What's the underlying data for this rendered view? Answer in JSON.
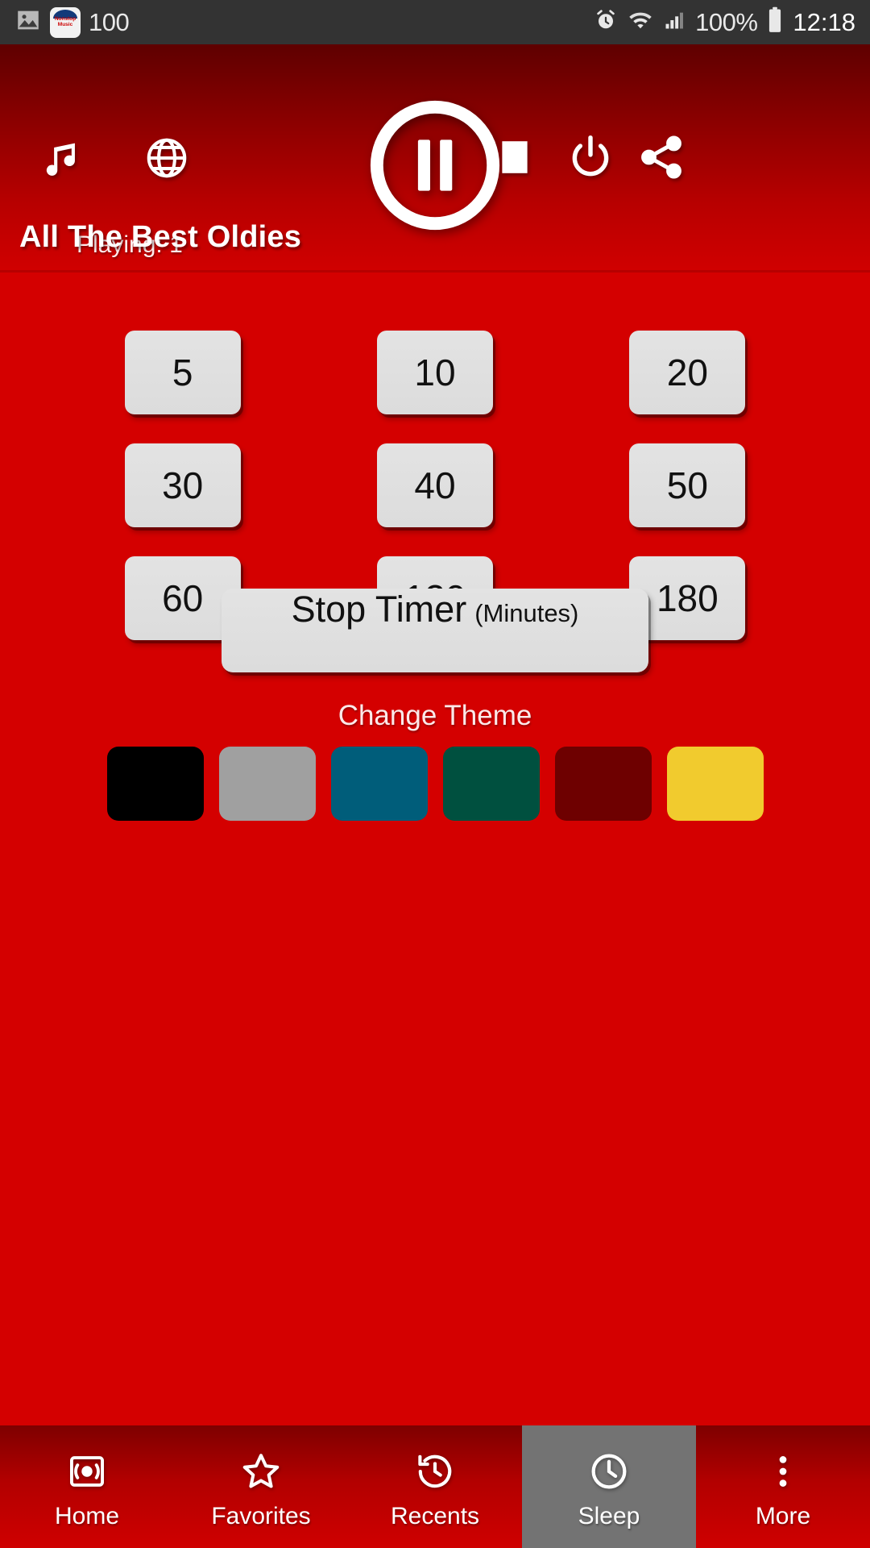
{
  "status_bar": {
    "left_icons": [
      "image-icon",
      "app-notification-icon"
    ],
    "app_badge_text": "Nonstop Music",
    "notification_count": "100",
    "right_icons": [
      "alarm-icon",
      "wifi-icon",
      "signal-icon",
      "battery-icon"
    ],
    "battery_percent": "100%",
    "time": "12:18"
  },
  "header": {
    "background_top": "#5e0000",
    "background_bottom": "#d10000",
    "music_icon": "music-note-icon",
    "globe_icon": "globe-icon",
    "pause_icon": "pause-circle-icon",
    "stop_icon": "stop-square-icon",
    "power_icon": "power-icon",
    "share_icon": "share-icon",
    "playing_label": "Playing: 1",
    "station_title": "All The Best Oldies"
  },
  "sleep_timer": {
    "buttons": [
      "5",
      "10",
      "20",
      "30",
      "40",
      "50",
      "60",
      "120",
      "180"
    ],
    "stop_timer_label": "Stop Timer",
    "stop_timer_unit": "(Minutes)"
  },
  "theme": {
    "heading": "Change Theme",
    "swatches": [
      {
        "name": "black",
        "color": "#000000"
      },
      {
        "name": "gray",
        "color": "#a0a0a0"
      },
      {
        "name": "teal-blue",
        "color": "#005d7a"
      },
      {
        "name": "dark-green",
        "color": "#00503f"
      },
      {
        "name": "dark-red",
        "color": "#6e0000"
      },
      {
        "name": "yellow",
        "color": "#f1cb2e"
      }
    ]
  },
  "bottom_nav": {
    "active_index": 3,
    "items": [
      {
        "label": "Home",
        "icon": "radio-icon"
      },
      {
        "label": "Favorites",
        "icon": "star-icon"
      },
      {
        "label": "Recents",
        "icon": "history-clock-icon"
      },
      {
        "label": "Sleep",
        "icon": "clock-icon"
      },
      {
        "label": "More",
        "icon": "overflow-dots-icon"
      }
    ]
  }
}
